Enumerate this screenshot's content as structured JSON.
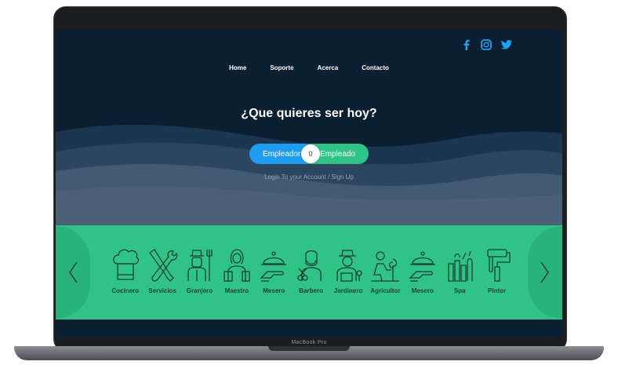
{
  "laptop": {
    "brand": "MacBook Pro"
  },
  "social": [
    {
      "name": "facebook-icon"
    },
    {
      "name": "instagram-icon"
    },
    {
      "name": "twitter-icon"
    }
  ],
  "nav": {
    "items": [
      "Home",
      "Soporte",
      "Acerca",
      "Contacto"
    ]
  },
  "hero": {
    "title": "¿Que quieres ser hoy?"
  },
  "toggle": {
    "left_label": "Empleador",
    "knob": "0",
    "right_label": "Empleado"
  },
  "login": {
    "text": "Login To your Account / Sign Up"
  },
  "jobs": [
    {
      "label": "Cocinero",
      "icon": "chef-hat-icon"
    },
    {
      "label": "Servicios",
      "icon": "tools-icon"
    },
    {
      "label": "Granjero",
      "icon": "farmer-icon"
    },
    {
      "label": "Maestro",
      "icon": "teacher-icon"
    },
    {
      "label": "Mesero",
      "icon": "waiter-tray-icon"
    },
    {
      "label": "Barbero",
      "icon": "barber-icon"
    },
    {
      "label": "Jardinero",
      "icon": "gardener-icon"
    },
    {
      "label": "Agricultor",
      "icon": "agriculturist-icon"
    },
    {
      "label": "Mesero",
      "icon": "waiter-tray-icon"
    },
    {
      "label": "Spa",
      "icon": "spa-icon"
    },
    {
      "label": "Pintor",
      "icon": "painter-roller-icon"
    }
  ],
  "colors": {
    "header_bg": "#0b1f33",
    "accent_blue": "#1e9cef",
    "accent_green": "#2fc486",
    "social_blue": "#1da1f2"
  }
}
